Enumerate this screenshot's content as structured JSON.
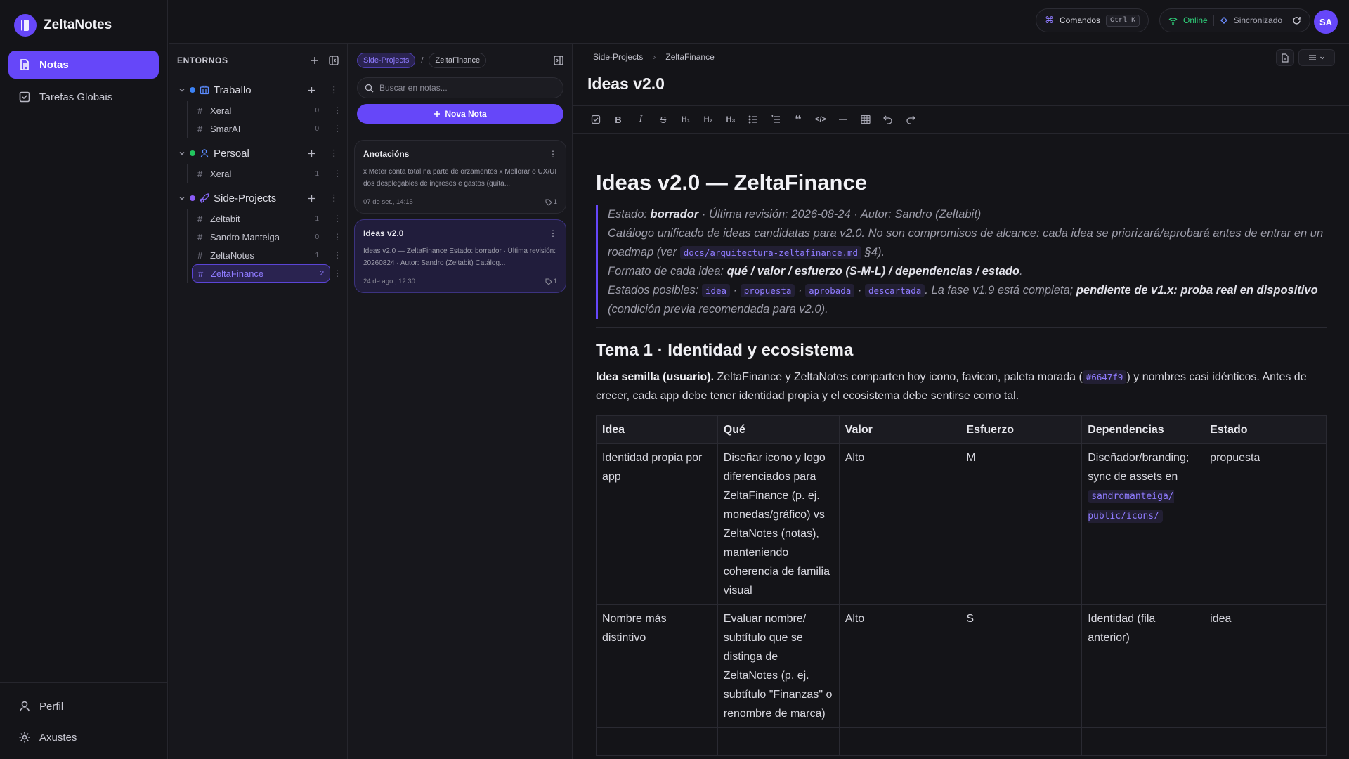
{
  "brand": {
    "name": "ZeltaNotes"
  },
  "nav": {
    "items": [
      {
        "label": "Notas",
        "icon": "note-icon",
        "active": true
      },
      {
        "label": "Tarefas Globais",
        "icon": "checkbox-icon",
        "active": false
      }
    ],
    "bottom": [
      {
        "label": "Perfil",
        "icon": "user-icon"
      },
      {
        "label": "Axustes",
        "icon": "gear-icon"
      }
    ]
  },
  "topbar": {
    "commands_label": "Comandos",
    "commands_shortcut": "Ctrl K",
    "status_online": "Online",
    "status_sync": "Sincronizado",
    "avatar_initials": "SA"
  },
  "environments": {
    "heading": "ENTORNOS",
    "groups": [
      {
        "name": "Traballo",
        "dot_color": "#3b82f6",
        "icon": "building-icon",
        "items": [
          {
            "name": "Xeral",
            "count": "0"
          },
          {
            "name": "SmarAI",
            "count": "0"
          }
        ]
      },
      {
        "name": "Persoal",
        "dot_color": "#22c55e",
        "icon": "person-icon",
        "items": [
          {
            "name": "Xeral",
            "count": "1"
          }
        ]
      },
      {
        "name": "Side-Projects",
        "dot_color": "#8b5cf6",
        "icon": "rocket-icon",
        "items": [
          {
            "name": "Zeltabit",
            "count": "1"
          },
          {
            "name": "Sandro Manteiga",
            "count": "0"
          },
          {
            "name": "ZeltaNotes",
            "count": "1"
          },
          {
            "name": "ZeltaFinance",
            "count": "2",
            "active": true
          }
        ]
      }
    ]
  },
  "notes_panel": {
    "crumb_1": "Side-Projects",
    "crumb_sep": "/",
    "crumb_2": "ZeltaFinance",
    "search_placeholder": "Buscar en notas...",
    "new_note_label": "Nova Nota",
    "cards": [
      {
        "title": "Anotacións",
        "body": "x Meter conta total na parte de orzamentos x Mellorar o UX/UI dos desplegables de ingresos e gastos (quita...",
        "date": "07 de set., 14:15",
        "tags": "1",
        "active": false
      },
      {
        "title": "Ideas v2.0",
        "body": "Ideas v2.0 — ZeltaFinance Estado: borrador · Última revisión: 20260824 · Autor: Sandro (Zeltabit) Catálog...",
        "date": "24 de ago., 12:30",
        "tags": "1",
        "active": true
      }
    ]
  },
  "editor": {
    "crumb_1": "Side-Projects",
    "crumb_2": "ZeltaFinance",
    "title": "Ideas v2.0",
    "toolbar": [
      "task",
      "bold",
      "italic",
      "strike",
      "h1",
      "h2",
      "h3",
      "bullet-list",
      "ordered-list",
      "quote",
      "code",
      "divider",
      "table",
      "undo",
      "redo"
    ],
    "doc": {
      "h1": "Ideas v2.0 — ZeltaFinance",
      "q1_a": "Estado: ",
      "q1_b": "borrador",
      "q1_c": " · Última revisión: 2026-08-24 · Autor: Sandro (Zeltabit)",
      "q2_a": "Catálogo unificado de ideas candidatas para v2.0. No son compromisos de alcance: cada idea se priorizará/aprobará antes de entrar en un roadmap (ver ",
      "q2_code": "docs/arquitectura-zeltafinance.md",
      "q2_b": " §4).",
      "q3_a": "Formato de cada idea: ",
      "q3_b": "qué / valor / esfuerzo (S-M-L) / dependencias / estado",
      "q3_c": ".",
      "q4_a": "Estados posibles: ",
      "q4_s1": "idea",
      "q4_s2": "propuesta",
      "q4_s3": "aprobada",
      "q4_s4": "descartada",
      "q4_sep": " · ",
      "q4_b": ". La fase v1.9 está completa; ",
      "q4_c": "pendiente de v1.x: proba real en dispositivo",
      "q4_d": " (condición previa recomendada para v2.0).",
      "h2": "Tema 1 · Identidad y ecosistema",
      "p_bold": "Idea semilla (usuario).",
      "p_a": " ZeltaFinance y ZeltaNotes comparten hoy icono, favicon, paleta morada (",
      "p_code": "#6647f9",
      "p_b": ") y nombres casi idénticos. Antes de crecer, cada app debe tener identidad propia y el ecosistema debe sentirse como tal.",
      "table": {
        "headers": [
          "Idea",
          "Qué",
          "Valor",
          "Esfuerzo",
          "Dependencias",
          "Estado"
        ],
        "rows": [
          {
            "idea": "Identidad propia por app",
            "que": "Diseñar icono y logo diferenciados para ZeltaFinance (p. ej. monedas/gráfico) vs ZeltaNotes (notas), manteniendo coherencia de familia visual",
            "valor": "Alto",
            "esfuerzo": "M",
            "dep_a": "Diseñador/branding; sync de assets en ",
            "dep_code": "sandromanteiga/ public/icons/",
            "estado": "propuesta"
          },
          {
            "idea": "Nombre más distintivo",
            "que": "Evaluar nombre/ subtítulo que se distinga de ZeltaNotes (p. ej. subtítulo \"Finanzas\" o renombre de marca)",
            "valor": "Alto",
            "esfuerzo": "S",
            "dep_a": "Identidad (fila anterior)",
            "dep_code": "",
            "estado": "idea"
          }
        ]
      }
    }
  },
  "colors": {
    "accent": "#6647f9",
    "online": "#2fd07a"
  }
}
